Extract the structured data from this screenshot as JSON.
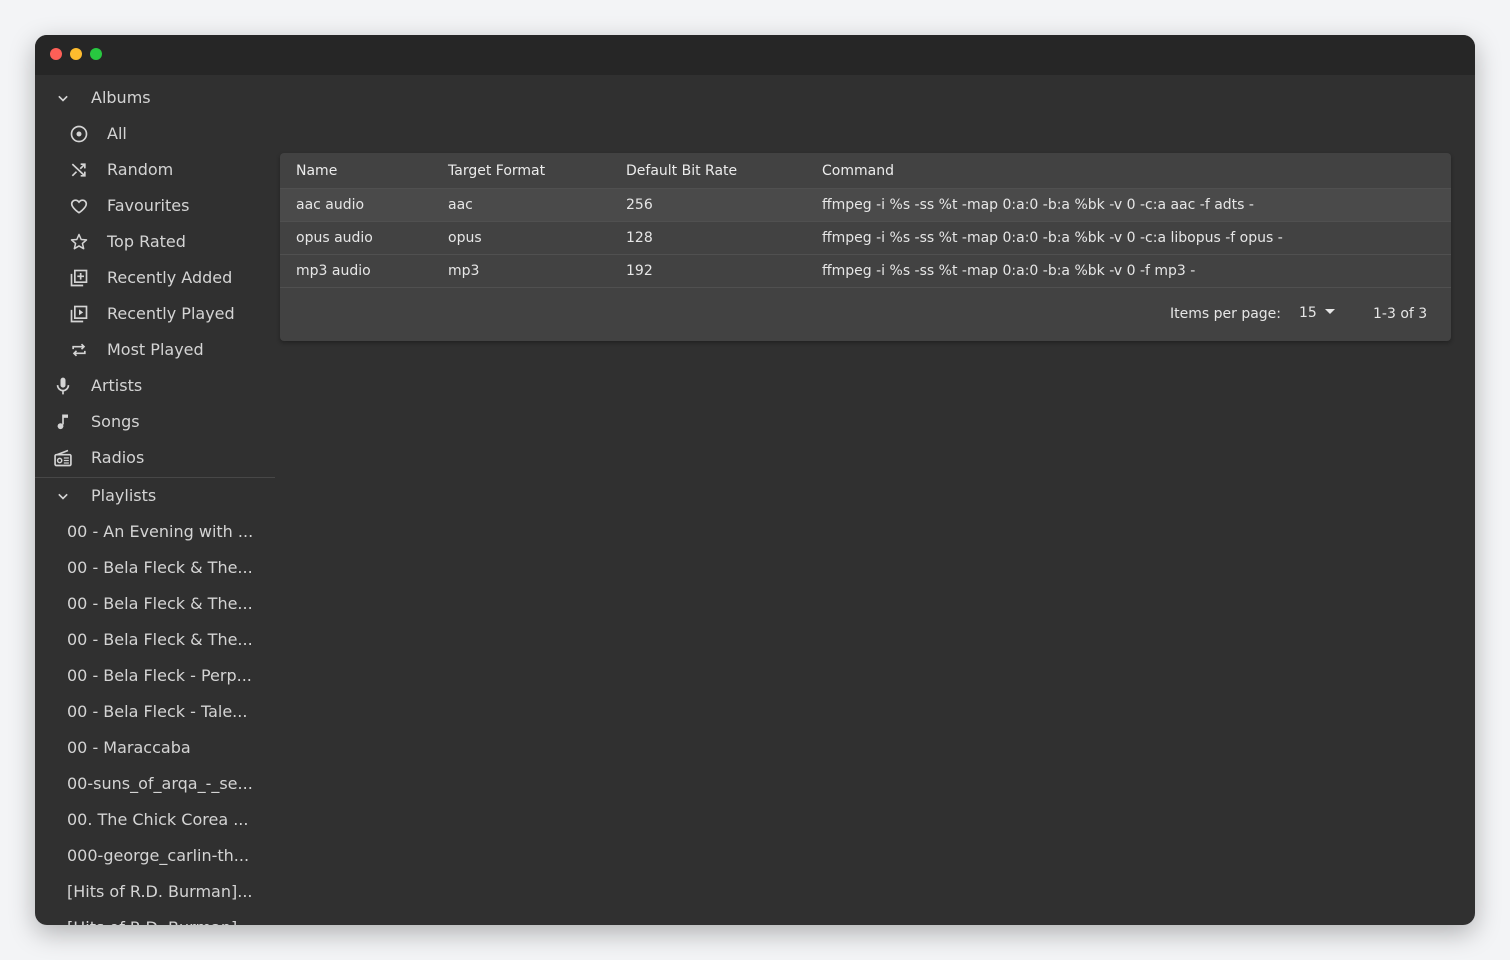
{
  "window": {
    "controls": [
      "close",
      "minimize",
      "maximize"
    ]
  },
  "sidebar": {
    "albums_header": {
      "label": "Albums",
      "icon": "chevron-down-icon"
    },
    "album_items": [
      {
        "label": "All",
        "icon": "album-icon"
      },
      {
        "label": "Random",
        "icon": "shuffle-icon"
      },
      {
        "label": "Favourites",
        "icon": "heart-icon"
      },
      {
        "label": "Top Rated",
        "icon": "star-icon"
      },
      {
        "label": "Recently Added",
        "icon": "library-add-icon"
      },
      {
        "label": "Recently Played",
        "icon": "library-play-icon"
      },
      {
        "label": "Most Played",
        "icon": "repeat-icon"
      }
    ],
    "top_items": [
      {
        "label": "Artists",
        "icon": "microphone-icon"
      },
      {
        "label": "Songs",
        "icon": "music-note-icon"
      },
      {
        "label": "Radios",
        "icon": "radio-icon"
      }
    ],
    "playlists_header": {
      "label": "Playlists",
      "icon": "chevron-down-icon"
    },
    "playlists": [
      "00 - An Evening with ...",
      "00 - Bela Fleck & The...",
      "00 - Bela Fleck & The...",
      "00 - Bela Fleck & The...",
      "00 - Bela Fleck - Perp...",
      "00 - Bela Fleck - Tale...",
      "00 - Maraccaba",
      "00-suns_of_arqa_-_se...",
      "00. The Chick Corea ...",
      "000-george_carlin-th...",
      "[Hits of R.D. Burman]...",
      "[Hits of R.D. Burman]..."
    ]
  },
  "table": {
    "headers": [
      "Name",
      "Target Format",
      "Default Bit Rate",
      "Command"
    ],
    "rows": [
      {
        "name": "aac audio",
        "format": "aac",
        "bitrate": "256",
        "command": "ffmpeg -i %s -ss %t -map 0:a:0 -b:a %bk -v 0 -c:a aac -f adts -"
      },
      {
        "name": "opus audio",
        "format": "opus",
        "bitrate": "128",
        "command": "ffmpeg -i %s -ss %t -map 0:a:0 -b:a %bk -v 0 -c:a libopus -f opus -"
      },
      {
        "name": "mp3 audio",
        "format": "mp3",
        "bitrate": "192",
        "command": "ffmpeg -i %s -ss %t -map 0:a:0 -b:a %bk -v 0 -f mp3 -"
      }
    ]
  },
  "pagination": {
    "items_per_page_label": "Items per page:",
    "items_per_page_value": "15",
    "range_text": "1-3 of 3"
  },
  "colors": {
    "window_bg": "#303030",
    "titlebar_bg": "#262626",
    "card_bg": "#424242",
    "text": "#d4d4d4",
    "close": "#fe5f57",
    "minimize": "#febc2e",
    "maximize": "#28c840"
  }
}
